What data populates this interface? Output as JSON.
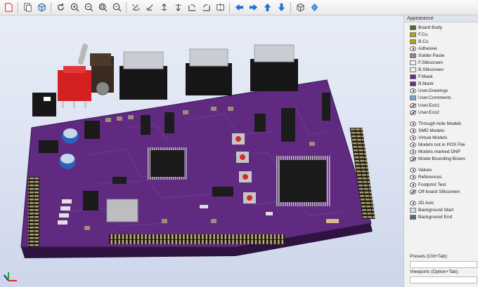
{
  "toolbar": {
    "buttons": [
      "reload-board-icon",
      "copy-image-icon",
      "view-3d-icon",
      "redraw-icon",
      "zoom-in-icon",
      "zoom-out-icon",
      "zoom-fit-icon",
      "zoom-selection-icon",
      "rotate-x-cw-icon",
      "rotate-x-ccw-icon",
      "rotate-y-cw-icon",
      "rotate-y-ccw-icon",
      "rotate-z-cw-icon",
      "rotate-z-ccw-icon",
      "flip-board-icon",
      "pan-left-icon",
      "pan-right-icon",
      "pan-up-icon",
      "pan-down-icon",
      "ortho-view-icon",
      "raytrace-icon"
    ],
    "arrow_color": "#1e6fd0"
  },
  "appearance": {
    "title": "Appearance",
    "layers": [
      {
        "label": "Board Body",
        "kind": "swatch",
        "color": "#4b6b2c"
      },
      {
        "label": "F.Cu",
        "kind": "swatch",
        "color": "#b9a021"
      },
      {
        "label": "B.Cu",
        "kind": "swatch",
        "color": "#b9a021"
      },
      {
        "label": "Adhesive",
        "kind": "eye"
      },
      {
        "label": "Solder Paste",
        "kind": "swatch",
        "color": "#8a8a8a"
      },
      {
        "label": "F.Silkscreen",
        "kind": "swatch",
        "color": "#f0f0f0"
      },
      {
        "label": "B.Silkscreen",
        "kind": "swatch",
        "color": "#f0f0f0"
      },
      {
        "label": "F.Mask",
        "kind": "swatch",
        "color": "#6b2a8e"
      },
      {
        "label": "B.Mask",
        "kind": "swatch",
        "color": "#6b2a8e"
      },
      {
        "label": "User.Drawings",
        "kind": "eye"
      },
      {
        "label": "User.Comments",
        "kind": "swatch",
        "color": "#7aa7c7"
      },
      {
        "label": "User.Eco1",
        "kind": "eye-off"
      },
      {
        "label": "User.Eco2",
        "kind": "eye-off"
      }
    ],
    "models": [
      {
        "label": "Through-hole Models",
        "kind": "eye"
      },
      {
        "label": "SMD Models",
        "kind": "eye"
      },
      {
        "label": "Virtual Models",
        "kind": "eye"
      },
      {
        "label": "Models not in POS File",
        "kind": "eye"
      },
      {
        "label": "Models marked DNP",
        "kind": "eye"
      },
      {
        "label": "Model Bounding Boxes",
        "kind": "eye-off"
      }
    ],
    "text": [
      {
        "label": "Values",
        "kind": "eye"
      },
      {
        "label": "References",
        "kind": "eye"
      },
      {
        "label": "Footprint Text",
        "kind": "eye"
      },
      {
        "label": "Off-board Silkscreen",
        "kind": "eye-off"
      }
    ],
    "other": [
      {
        "label": "3D Axis",
        "kind": "eye"
      },
      {
        "label": "Background Start",
        "kind": "swatch",
        "color": "#d6dbe8"
      },
      {
        "label": "Background End",
        "kind": "swatch",
        "color": "#5f6473"
      }
    ],
    "presets_label": "Presets (Ctrl+Tab):",
    "viewports_label": "Viewports (Option+Tab):"
  }
}
